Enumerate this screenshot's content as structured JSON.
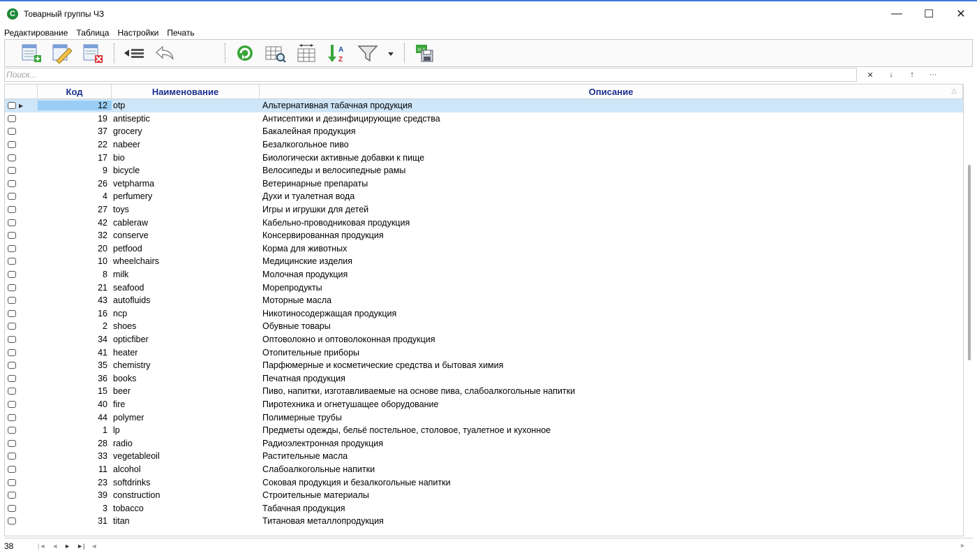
{
  "window": {
    "title": "Товарный группы ЧЗ",
    "app_icon_letter": "C",
    "minimize": "—",
    "maximize": "☐",
    "close": "✕"
  },
  "menu": [
    "Редактирование",
    "Таблица",
    "Настройки",
    "Печать"
  ],
  "toolbar_icons": [
    "add-record-icon",
    "edit-record-icon",
    "delete-record-icon",
    "insert-row-icon",
    "undo-icon",
    "refresh-icon",
    "grid-search-icon",
    "column-width-icon",
    "sort-az-icon",
    "filter-icon",
    "dropdown-icon",
    "export-xls-icon"
  ],
  "search": {
    "placeholder": "Поиск...",
    "clear": "✕",
    "next": "↓",
    "prev": "↑",
    "more": "···"
  },
  "grid": {
    "columns": {
      "kod": "Код",
      "name": "Наименование",
      "desc": "Описание"
    },
    "sort_indicator": "△",
    "rows": [
      {
        "kod": "12",
        "name": "otp",
        "desc": "Альтернативная табачная продукция"
      },
      {
        "kod": "19",
        "name": "antiseptic",
        "desc": "Антисептики и дезинфицирующие средства"
      },
      {
        "kod": "37",
        "name": "grocery",
        "desc": "Бакалейная продукция"
      },
      {
        "kod": "22",
        "name": "nabeer",
        "desc": "Безалкогольное пиво"
      },
      {
        "kod": "17",
        "name": "bio",
        "desc": "Биологически активные добавки к пище"
      },
      {
        "kod": "9",
        "name": "bicycle",
        "desc": "Велосипеды и велосипедные рамы"
      },
      {
        "kod": "26",
        "name": "vetpharma",
        "desc": "Ветеринарные препараты"
      },
      {
        "kod": "4",
        "name": "perfumery",
        "desc": "Духи и туалетная вода"
      },
      {
        "kod": "27",
        "name": "toys",
        "desc": "Игры и игрушки для детей"
      },
      {
        "kod": "42",
        "name": "cableraw",
        "desc": "Кабельно-проводниковая продукция"
      },
      {
        "kod": "32",
        "name": "conserve",
        "desc": "Консервированная продукция"
      },
      {
        "kod": "20",
        "name": "petfood",
        "desc": "Корма для животных"
      },
      {
        "kod": "10",
        "name": "wheelchairs",
        "desc": "Медицинские изделия"
      },
      {
        "kod": "8",
        "name": "milk",
        "desc": "Молочная продукция"
      },
      {
        "kod": "21",
        "name": "seafood",
        "desc": "Морепродукты"
      },
      {
        "kod": "43",
        "name": "autofluids",
        "desc": "Моторные масла"
      },
      {
        "kod": "16",
        "name": "ncp",
        "desc": "Никотиносодержащая продукция"
      },
      {
        "kod": "2",
        "name": "shoes",
        "desc": "Обувные товары"
      },
      {
        "kod": "34",
        "name": "opticfiber",
        "desc": "Оптоволокно и оптоволоконная продукция"
      },
      {
        "kod": "41",
        "name": "heater",
        "desc": "Отопительные приборы"
      },
      {
        "kod": "35",
        "name": "chemistry",
        "desc": "Парфюмерные и косметические средства и бытовая химия"
      },
      {
        "kod": "36",
        "name": "books",
        "desc": "Печатная продукция"
      },
      {
        "kod": "15",
        "name": "beer",
        "desc": "Пиво, напитки, изготавливаемые на основе пива, слабоалкогольные напитки"
      },
      {
        "kod": "40",
        "name": "fire",
        "desc": "Пиротехника и огнетушащее оборудование"
      },
      {
        "kod": "44",
        "name": "polymer",
        "desc": "Полимерные трубы"
      },
      {
        "kod": "1",
        "name": "lp",
        "desc": "Предметы одежды, бельё постельное, столовое, туалетное и кухонное"
      },
      {
        "kod": "28",
        "name": "radio",
        "desc": "Радиоэлектронная продукция"
      },
      {
        "kod": "33",
        "name": "vegetableoil",
        "desc": "Растительные масла"
      },
      {
        "kod": "11",
        "name": "alcohol",
        "desc": "Слабоалкогольные напитки"
      },
      {
        "kod": "23",
        "name": "softdrinks",
        "desc": "Соковая продукция и безалкогольные напитки"
      },
      {
        "kod": "39",
        "name": "construction",
        "desc": "Строительные материалы"
      },
      {
        "kod": "3",
        "name": "tobacco",
        "desc": "Табачная продукция"
      },
      {
        "kod": "31",
        "name": "titan",
        "desc": "Титановая металлопродукция"
      }
    ]
  },
  "status": {
    "count": "38",
    "nav": [
      "|◄",
      "◄",
      "►",
      "►|",
      "◄"
    ],
    "scroll_right": "►"
  },
  "colors": {
    "header_text": "#1b2f8f",
    "selected_row": "#cfe6f9",
    "selected_cell": "#99cdf5"
  }
}
